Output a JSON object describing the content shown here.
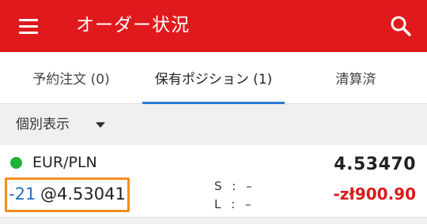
{
  "appbar": {
    "title": "オーダー状況",
    "menu_icon": "hamburger-menu-icon",
    "search_icon": "search-icon",
    "color": "#e0191d"
  },
  "tabs": [
    {
      "label": "予約注文 (0)",
      "selected": false
    },
    {
      "label": "保有ポジション (1)",
      "selected": true
    },
    {
      "label": "清算済",
      "selected": false
    }
  ],
  "filter": {
    "label": "個別表示"
  },
  "position": {
    "symbol": "EUR/PLN",
    "status_color": "#1fb33a",
    "price": "4.53470",
    "quantity": "-21",
    "entry": "@4.53041",
    "stop_loss": "S : –",
    "limit": "L : –",
    "pnl": "-zł900.90"
  }
}
